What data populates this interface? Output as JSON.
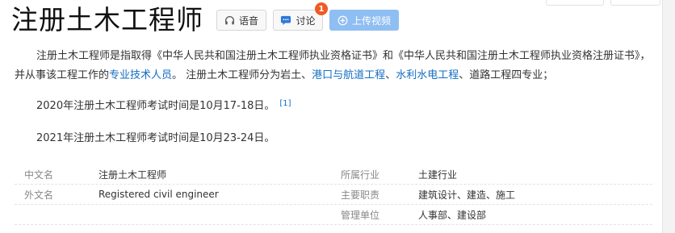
{
  "title": "注册土木工程师",
  "buttons": {
    "voice": "语音",
    "discuss": "讨论",
    "discuss_badge": "1",
    "upload": "上传视频"
  },
  "paragraph1": {
    "t1": "注册土木工程师是指取得《中华人民共和国注册土木工程师执业资格证书》和《中华人民共和国注册土木工程师执业资格注册证书》，并从事该工程工作的",
    "link1": "专业技术人员",
    "t2": "。 注册土木工程师分为岩土、",
    "link2": "港口与航道工程",
    "t3": "、",
    "link3": "水利水电工程",
    "t4": "、道路工程四专业；"
  },
  "paragraph2": {
    "text": "2020年注册土木工程师考试时间是10月17-18日。",
    "ref": "[1]"
  },
  "paragraph3": {
    "text": "2021年注册土木工程师考试时间是10月23-24日。"
  },
  "info": [
    {
      "k1": "中文名",
      "v1": "注册土木工程师",
      "k2": "所属行业",
      "v2": "土建行业"
    },
    {
      "k1": "外文名",
      "v1": "Registered civil engineer",
      "k2": "主要职责",
      "v2": "建筑设计、建造、施工"
    },
    {
      "k1": "",
      "v1": "",
      "k2": "管理单位",
      "v2": "人事部、建设部"
    }
  ],
  "colors": {
    "link": "#136ec2",
    "upload_bg": "#8fbef3",
    "badge": "#f05a24"
  },
  "icons": [
    "headphones-icon",
    "chat-icon",
    "plus-circle-icon"
  ]
}
